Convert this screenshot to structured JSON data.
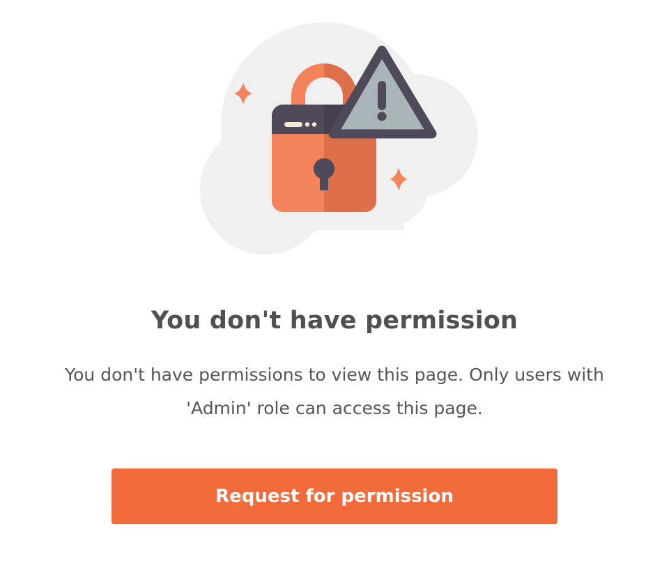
{
  "illustration": {
    "icons": [
      "lock-icon",
      "warning-icon",
      "sparkle-icon"
    ],
    "colors": {
      "cloud": "#f0f0f0",
      "lock_body": "#f2835a",
      "lock_body_shade": "#dd6f4b",
      "lock_top": "#4f4a5a",
      "warning_fill": "#a9b5b8",
      "warning_stroke": "#4f4a5a",
      "sparkle": "#f2835a"
    }
  },
  "content": {
    "title": "You don't have permission",
    "description": "You don't have permissions to view this page. Only users with 'Admin' role can access this page."
  },
  "actions": {
    "request_label": "Request for permission",
    "accent_color": "#f26b3a"
  }
}
